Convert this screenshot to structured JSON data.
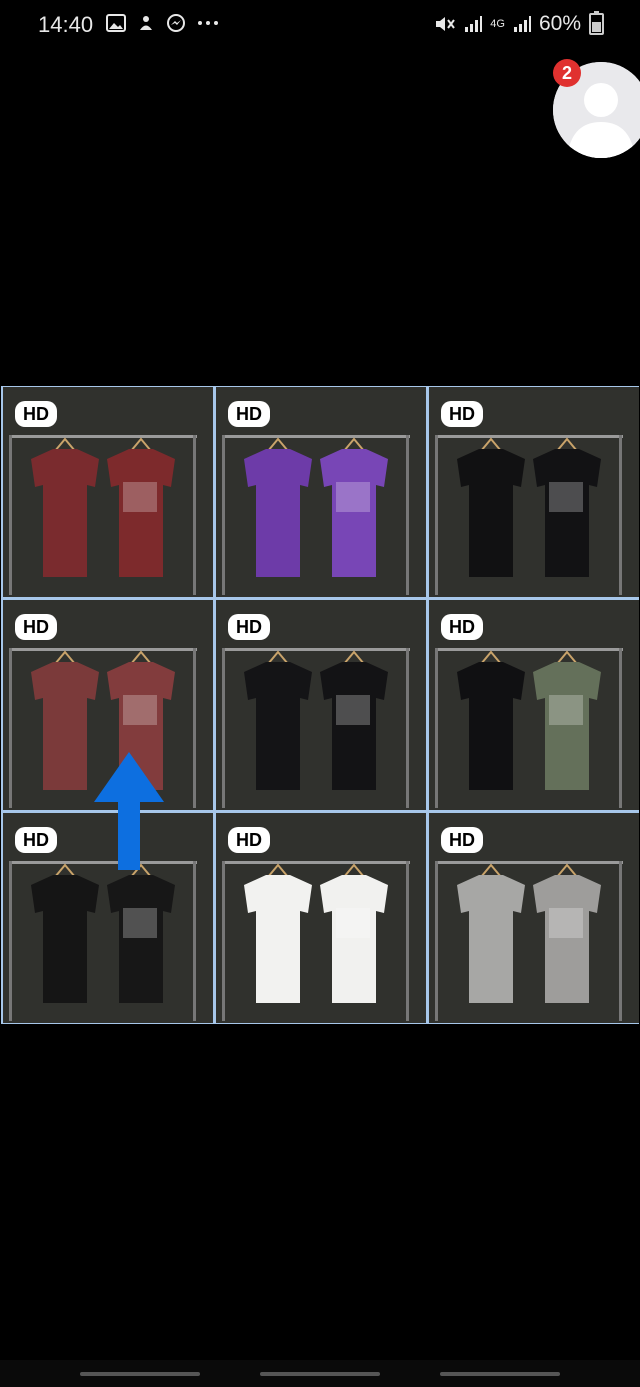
{
  "status_bar": {
    "time": "14:40",
    "left_icons": [
      "image-icon",
      "download-icon",
      "messenger-icon",
      "more-icon"
    ],
    "signal_label": "4G",
    "battery": "60%"
  },
  "chat_head": {
    "badge_count": "2"
  },
  "gallery": {
    "tiles": [
      {
        "hd": "HD",
        "shirt_color_a": "#7a2b2e",
        "shirt_color_b": "#7d2a2c"
      },
      {
        "hd": "HD",
        "shirt_color_a": "#6d3ba8",
        "shirt_color_b": "#7846b6"
      },
      {
        "hd": "HD",
        "shirt_color_a": "#111112",
        "shirt_color_b": "#121214"
      },
      {
        "hd": "HD",
        "shirt_color_a": "#7b3a3a",
        "shirt_color_b": "#823c3d"
      },
      {
        "hd": "HD",
        "shirt_color_a": "#141416",
        "shirt_color_b": "#131315"
      },
      {
        "hd": "HD",
        "shirt_color_a": "#101012",
        "shirt_color_b": "#64705a"
      },
      {
        "hd": "HD",
        "shirt_color_a": "#151515",
        "shirt_color_b": "#171717"
      },
      {
        "hd": "HD",
        "shirt_color_a": "#f2f2f0",
        "shirt_color_b": "#f1f1ef"
      },
      {
        "hd": "HD",
        "shirt_color_a": "#a7a7a5",
        "shirt_color_b": "#9e9d9b"
      }
    ],
    "arrow_color": "#0d6fe0"
  }
}
